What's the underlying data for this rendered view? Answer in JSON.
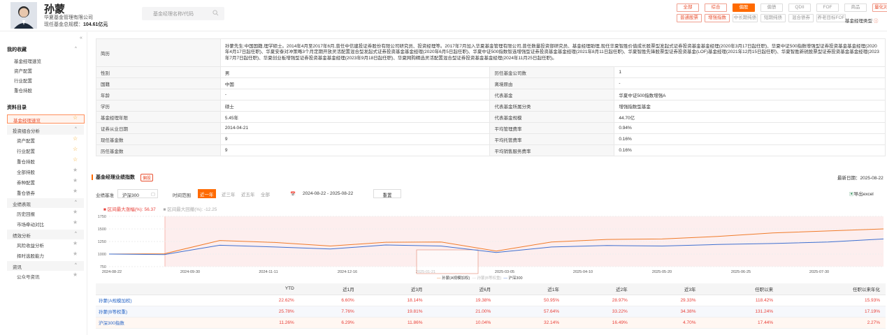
{
  "header": {
    "manager_name": "孙蒙",
    "company": "华夏基金管理有限公司",
    "scale_label": "现任基金总规模：",
    "scale_value": "104.61亿元",
    "search_placeholder": "基金经理名称/代码",
    "buttons_row1": [
      "全部",
      "综合",
      "偏股",
      "偏债",
      "QDII",
      "FOF",
      "商品",
      "量化对冲"
    ],
    "buttons_row2": [
      "普通股票",
      "增强指数",
      "中长期纯债",
      "短期纯债",
      "混合债券",
      "养老目标FOF"
    ],
    "type_label": "基金经理类型"
  },
  "sidebar": {
    "collapse": "«",
    "section1": "我的收藏",
    "items1": [
      "基金经理速览",
      "资产配置",
      "行业配置",
      "重仓持股"
    ],
    "section2": "资料目录",
    "active": "基金经理速览",
    "groups": [
      {
        "label": "投资组合分析",
        "items": [
          "资产配置",
          "行业配置",
          "重仓持股",
          "全部持股",
          "券种配置",
          "重仓债券"
        ]
      },
      {
        "label": "业绩表现",
        "items": [
          "历史回报",
          "市场牵动对比"
        ]
      },
      {
        "label": "绩效分析",
        "items": [
          "风险收益分析",
          "择时选股能力"
        ]
      },
      {
        "label": "资讯",
        "items": [
          "公众号资讯"
        ]
      }
    ]
  },
  "info": {
    "bio_label": "简历",
    "bio": "孙蒙先生:中国国籍,理学硕士。2014年4月至2017年6月,曾任中信建投证券股份有限公司研究员、投资经理等。2017年7月加入华夏基金管理有限公司,曾任数量投资部研究员、基金经理助理,现任华夏智胜价值成长股票型发起式证券投资基金基金经理(2020年3月17日起任职)、华夏中证500指数增强型证券投资基金基金经理(2020年4月17日起任职)、华夏安泰对冲策略3个月定期开放灵活配置混合型发起式证券投资基金基金经理(2020年6月5日起任职)、华夏中证500指数智选增强型证券投资基金基金经理(2021年8月11日起任职)、华夏智胜先锋股票型证券投资基金(LOF)基金经理(2021年12月15日起任职)、华夏智胜新锐股票型证券投资基金基金经理(2023年7月7日起任职)、华夏创业板增强型证券投资基金基金经理(2023年9月18日起任职)、华夏网购精选灵活配置混合型证券投资基金基金经理(2024年11月25日起任职)。",
    "rows": [
      {
        "k1": "性别",
        "v1": "男",
        "k2": "历任基金公司数",
        "v2": "1"
      },
      {
        "k1": "国籍",
        "v1": "中国",
        "k2": "离境原由",
        "v2": "-"
      },
      {
        "k1": "年龄",
        "v1": "-",
        "k2": "代表基金",
        "v2": "华夏中证500指数增强A"
      },
      {
        "k1": "学历",
        "v1": "硕士",
        "k2": "代表基金所属分类",
        "v2": "增强指数型基金"
      },
      {
        "k1": "基金经理年限",
        "v1": "5.45年",
        "k2": "代表基金规模",
        "v2": "44.70亿"
      },
      {
        "k1": "证券从业日期",
        "v1": "2014-04-21",
        "k2": "平均管理费率",
        "v2": "0.94%"
      },
      {
        "k1": "现任基金数",
        "v1": "9",
        "k2": "平均托管费率",
        "v2": "0.16%"
      },
      {
        "k1": "历任基金数",
        "v1": "9",
        "k2": "平均销售服务费率",
        "v2": "0.16%"
      }
    ]
  },
  "perf": {
    "title": "基金经理业绩指数",
    "tag": "偏股",
    "update": "最新日期：2025-08-22",
    "bench_label": "业绩基准",
    "bench_value": "沪深300",
    "range_label": "时间范围",
    "ranges": [
      "近一年",
      "近三年",
      "近五年",
      "全部"
    ],
    "date_range": "2024-08-22  -  2025-08-22",
    "reset": "重置",
    "export": "导出excel",
    "max_up": "■ 区间最大涨幅(%): 56.37",
    "max_down": "■ 区间最大回撤(%): -12.25"
  },
  "chart_data": {
    "type": "line",
    "x": [
      "2024-08-22",
      "2024-09-30",
      "2024-11-11",
      "2024-12-16",
      "2025-01-21",
      "2025-03-05",
      "2025-04-10",
      "2025-05-20",
      "2025-06-25",
      "2025-07-30"
    ],
    "ylim": [
      750,
      1750
    ],
    "yticks": [
      750,
      1000,
      1250,
      1500,
      1750
    ],
    "series": [
      {
        "name": "孙蒙(A规模加权)",
        "color": "#f07b2a",
        "values": [
          1000,
          1005,
          1270,
          1230,
          1160,
          1235,
          1240,
          1060,
          1240,
          1290,
          1300,
          1350,
          1420,
          1460,
          1500
        ]
      },
      {
        "name": "孙蒙(B等权重)",
        "color": "#cccccc",
        "values": []
      },
      {
        "name": "沪深300",
        "color": "#3e6fd0",
        "values": [
          1000,
          990,
          1175,
          1140,
          1100,
          1180,
          1160,
          1030,
          1140,
          1170,
          1160,
          1190,
          1210,
          1240,
          1300
        ]
      }
    ]
  },
  "table": {
    "headers": [
      "",
      "YTD",
      "近1月",
      "近3月",
      "近6月",
      "近1年",
      "近2年",
      "近3年",
      "任职以来",
      "任职以来年化"
    ],
    "rows": [
      [
        "孙蒙(A规模加权)",
        "22.62%",
        "6.60%",
        "18.14%",
        "19.38%",
        "50.95%",
        "28.97%",
        "29.33%",
        "118.42%",
        "15.93%"
      ],
      [
        "孙蒙(B等权重)",
        "25.78%",
        "7.76%",
        "19.81%",
        "21.00%",
        "57.64%",
        "33.22%",
        "34.38%",
        "131.24%",
        "17.19%"
      ],
      [
        "沪深300指数",
        "11.26%",
        "6.29%",
        "11.86%",
        "10.04%",
        "32.14%",
        "16.49%",
        "4.70%",
        "17.44%",
        "2.27%"
      ]
    ]
  }
}
